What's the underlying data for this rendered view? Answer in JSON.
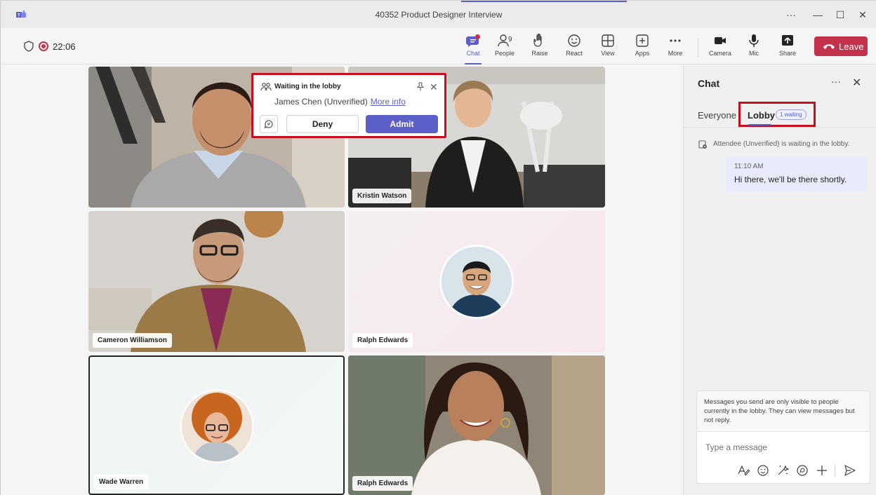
{
  "window": {
    "title": "40352 Product Designer Interview",
    "controls": {
      "more": "···",
      "minimize": "—",
      "maximize": "☐",
      "close": "✕"
    }
  },
  "meeting": {
    "elapsed": "22:06",
    "people_count": "9"
  },
  "toolbar": {
    "chat": "Chat",
    "people": "People",
    "raise": "Raise",
    "react": "React",
    "view": "View",
    "apps": "Apps",
    "more": "More",
    "camera": "Camera",
    "mic": "Mic",
    "share": "Share",
    "leave": "Leave"
  },
  "participants": [
    {
      "name": ""
    },
    {
      "name": "Kristin Watson"
    },
    {
      "name": "Cameron Williamson"
    },
    {
      "name": "Ralph Edwards"
    },
    {
      "name": "Wade Warren"
    },
    {
      "name": "Ralph Edwards"
    }
  ],
  "lobby_popup": {
    "title": "Waiting in the lobby",
    "person": "James Chen (Unverified)",
    "more_info": "More info",
    "deny": "Deny",
    "admit": "Admit"
  },
  "chat_panel": {
    "title": "Chat",
    "more": "···",
    "tabs": {
      "everyone": "Everyone",
      "lobby": "Lobby",
      "waiting_badge": "1 waiting"
    },
    "system_message": "Attendee (Unverified) is waiting in the lobby.",
    "messages": [
      {
        "time": "11:10 AM",
        "text": "Hi there, we'll be there shortly."
      }
    ],
    "notice": "Messages you send are only visible to people currently in the lobby. They can view messages but not reply.",
    "input_placeholder": "Type a message"
  },
  "colors": {
    "accent": "#5b5fc7",
    "leave": "#c4314b",
    "highlight_box": "#c50f1f"
  },
  "icons": [
    "teams-logo-icon",
    "shield-icon",
    "recording-icon",
    "chat-icon",
    "people-icon",
    "raise-hand-icon",
    "react-icon",
    "view-icon",
    "apps-icon",
    "more-icon",
    "camera-icon",
    "mic-icon",
    "share-icon",
    "phone-hangup-icon",
    "lobby-icon",
    "pin-icon",
    "close-icon",
    "message-icon",
    "format-icon",
    "emoji-icon",
    "sticker-icon",
    "loop-icon",
    "add-icon",
    "send-icon"
  ]
}
